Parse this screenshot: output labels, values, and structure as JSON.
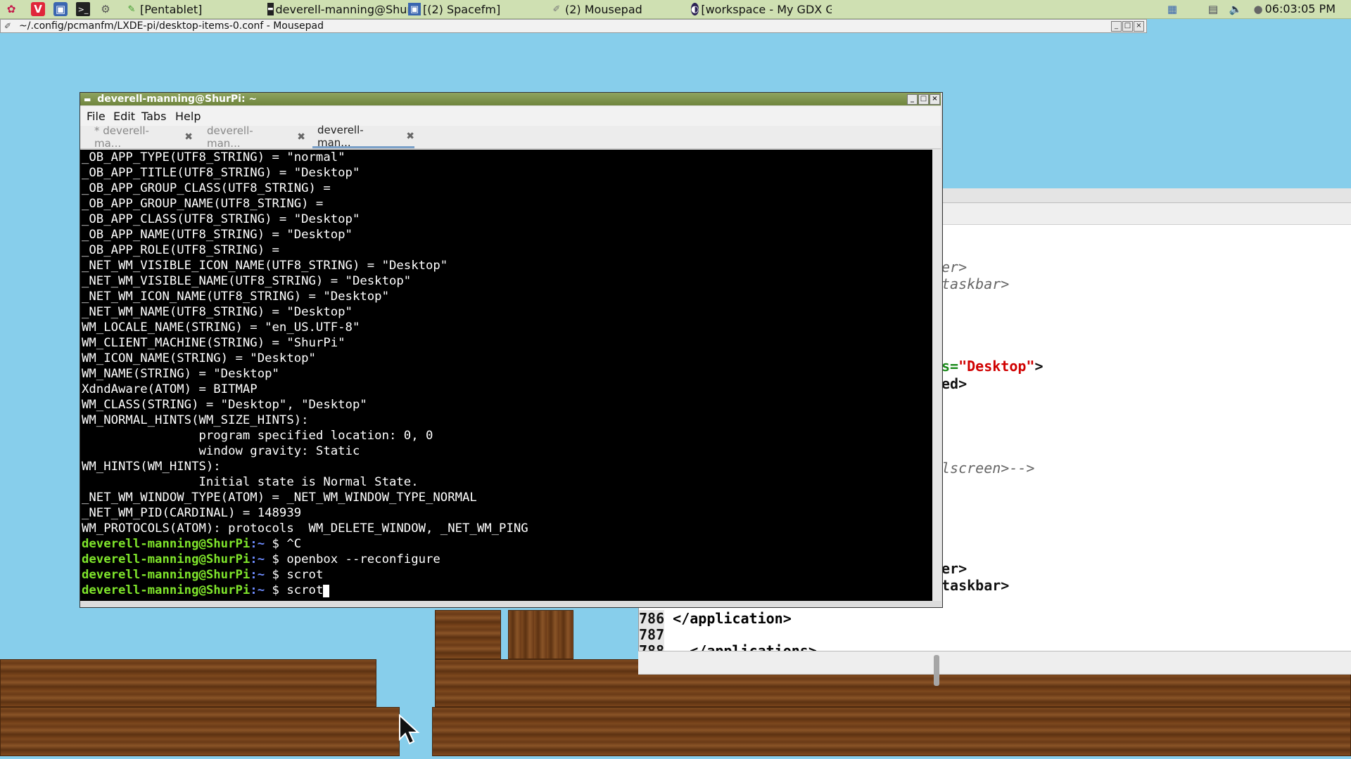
{
  "taskbar": {
    "tasks": [
      {
        "label": "[Pentablet]",
        "icon": "pentablet-icon"
      },
      {
        "label": "deverell-manning@Shur...",
        "icon": "terminal-icon"
      },
      {
        "label": "[(2) Spacefm]",
        "icon": "file-manager-icon"
      },
      {
        "label": "(2) Mousepad",
        "icon": "text-editor-icon"
      },
      {
        "label": "[workspace - My GDX G...",
        "icon": "eclipse-icon"
      }
    ],
    "clock": "06:03:05 PM"
  },
  "mousepad_window": {
    "title": "~/.config/pcmanfm/LXDE-pi/desktop-items-0.conf - Mousepad"
  },
  "terminal": {
    "title": "deverell-manning@ShurPi: ~",
    "menu": [
      "File",
      "Edit",
      "Tabs",
      "Help"
    ],
    "tabs": [
      {
        "label": "* deverell-ma...",
        "active": false
      },
      {
        "label": "deverell-man...",
        "active": false
      },
      {
        "label": "deverell-man...",
        "active": true
      }
    ],
    "output_lines": [
      "_OB_APP_TYPE(UTF8_STRING) = \"normal\"",
      "_OB_APP_TITLE(UTF8_STRING) = \"Desktop\"",
      "_OB_APP_GROUP_CLASS(UTF8_STRING) =",
      "_OB_APP_GROUP_NAME(UTF8_STRING) =",
      "_OB_APP_CLASS(UTF8_STRING) = \"Desktop\"",
      "_OB_APP_NAME(UTF8_STRING) = \"Desktop\"",
      "_OB_APP_ROLE(UTF8_STRING) =",
      "_NET_WM_VISIBLE_ICON_NAME(UTF8_STRING) = \"Desktop\"",
      "_NET_WM_VISIBLE_NAME(UTF8_STRING) = \"Desktop\"",
      "_NET_WM_ICON_NAME(UTF8_STRING) = \"Desktop\"",
      "_NET_WM_NAME(UTF8_STRING) = \"Desktop\"",
      "WM_LOCALE_NAME(STRING) = \"en_US.UTF-8\"",
      "WM_CLIENT_MACHINE(STRING) = \"ShurPi\"",
      "WM_ICON_NAME(STRING) = \"Desktop\"",
      "WM_NAME(STRING) = \"Desktop\"",
      "XdndAware(ATOM) = BITMAP",
      "WM_CLASS(STRING) = \"Desktop\", \"Desktop\"",
      "WM_NORMAL_HINTS(WM_SIZE_HINTS):",
      "                program specified location: 0, 0",
      "                window gravity: Static",
      "WM_HINTS(WM_HINTS):",
      "                Initial state is Normal State.",
      "_NET_WM_WINDOW_TYPE(ATOM) = _NET_WM_WINDOW_TYPE_NORMAL",
      "_NET_WM_PID(CARDINAL) = 148939",
      "WM_PROTOCOLS(ATOM): protocols  WM_DELETE_WINDOW, _NET_WM_PING"
    ],
    "prompt_user": "deverell-manning@ShurPi",
    "prompt_path": ":~",
    "prompt_symbol": "$",
    "commands": [
      "^C",
      "openbox --reconfigure",
      "scrot",
      "scrot"
    ]
  },
  "editor_fragments": {
    "f1": "er>",
    "f2": "taskbar>",
    "f3_attr": "s=",
    "f3_value": "\"Desktop\"",
    "f3_end": ">",
    "f4": "ed>",
    "f5": "lscreen>-->",
    "f6": "er>",
    "f7": "taskbar>"
  },
  "editor_lower": {
    "lines": [
      {
        "num": "786",
        "text": "</application>"
      },
      {
        "num": "787",
        "text": ""
      },
      {
        "num": "788",
        "text": "  </applications>"
      }
    ]
  },
  "colors": {
    "taskbar_bg": "#cfe0b2",
    "desktop_bg": "#87ceeb",
    "terminal_title": "#7a8f47",
    "prompt_green": "#7fe52b",
    "string_red": "#d00000"
  }
}
